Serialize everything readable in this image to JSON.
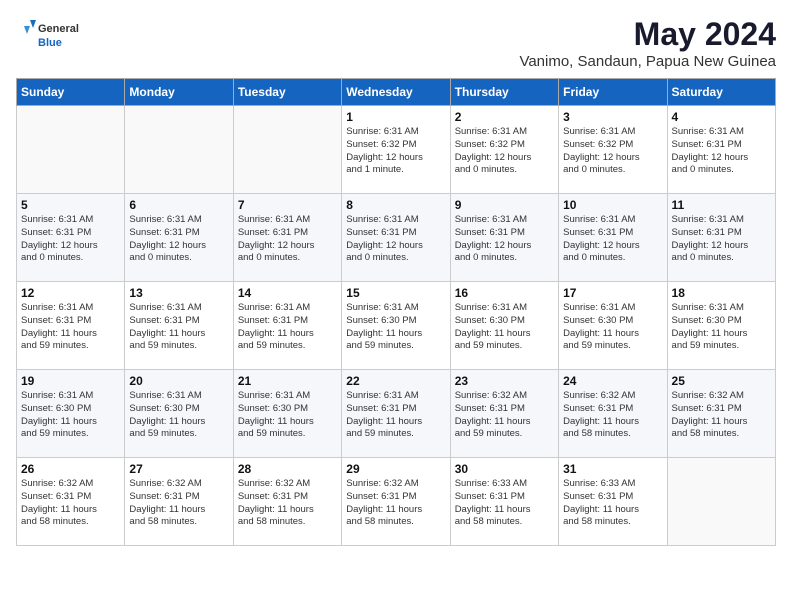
{
  "logo": {
    "general": "General",
    "blue": "Blue"
  },
  "title": "May 2024",
  "subtitle": "Vanimo, Sandaun, Papua New Guinea",
  "weekdays": [
    "Sunday",
    "Monday",
    "Tuesday",
    "Wednesday",
    "Thursday",
    "Friday",
    "Saturday"
  ],
  "weeks": [
    [
      {
        "day": "",
        "text": ""
      },
      {
        "day": "",
        "text": ""
      },
      {
        "day": "",
        "text": ""
      },
      {
        "day": "1",
        "text": "Sunrise: 6:31 AM\nSunset: 6:32 PM\nDaylight: 12 hours\nand 1 minute."
      },
      {
        "day": "2",
        "text": "Sunrise: 6:31 AM\nSunset: 6:32 PM\nDaylight: 12 hours\nand 0 minutes."
      },
      {
        "day": "3",
        "text": "Sunrise: 6:31 AM\nSunset: 6:32 PM\nDaylight: 12 hours\nand 0 minutes."
      },
      {
        "day": "4",
        "text": "Sunrise: 6:31 AM\nSunset: 6:31 PM\nDaylight: 12 hours\nand 0 minutes."
      }
    ],
    [
      {
        "day": "5",
        "text": "Sunrise: 6:31 AM\nSunset: 6:31 PM\nDaylight: 12 hours\nand 0 minutes."
      },
      {
        "day": "6",
        "text": "Sunrise: 6:31 AM\nSunset: 6:31 PM\nDaylight: 12 hours\nand 0 minutes."
      },
      {
        "day": "7",
        "text": "Sunrise: 6:31 AM\nSunset: 6:31 PM\nDaylight: 12 hours\nand 0 minutes."
      },
      {
        "day": "8",
        "text": "Sunrise: 6:31 AM\nSunset: 6:31 PM\nDaylight: 12 hours\nand 0 minutes."
      },
      {
        "day": "9",
        "text": "Sunrise: 6:31 AM\nSunset: 6:31 PM\nDaylight: 12 hours\nand 0 minutes."
      },
      {
        "day": "10",
        "text": "Sunrise: 6:31 AM\nSunset: 6:31 PM\nDaylight: 12 hours\nand 0 minutes."
      },
      {
        "day": "11",
        "text": "Sunrise: 6:31 AM\nSunset: 6:31 PM\nDaylight: 12 hours\nand 0 minutes."
      }
    ],
    [
      {
        "day": "12",
        "text": "Sunrise: 6:31 AM\nSunset: 6:31 PM\nDaylight: 11 hours\nand 59 minutes."
      },
      {
        "day": "13",
        "text": "Sunrise: 6:31 AM\nSunset: 6:31 PM\nDaylight: 11 hours\nand 59 minutes."
      },
      {
        "day": "14",
        "text": "Sunrise: 6:31 AM\nSunset: 6:31 PM\nDaylight: 11 hours\nand 59 minutes."
      },
      {
        "day": "15",
        "text": "Sunrise: 6:31 AM\nSunset: 6:30 PM\nDaylight: 11 hours\nand 59 minutes."
      },
      {
        "day": "16",
        "text": "Sunrise: 6:31 AM\nSunset: 6:30 PM\nDaylight: 11 hours\nand 59 minutes."
      },
      {
        "day": "17",
        "text": "Sunrise: 6:31 AM\nSunset: 6:30 PM\nDaylight: 11 hours\nand 59 minutes."
      },
      {
        "day": "18",
        "text": "Sunrise: 6:31 AM\nSunset: 6:30 PM\nDaylight: 11 hours\nand 59 minutes."
      }
    ],
    [
      {
        "day": "19",
        "text": "Sunrise: 6:31 AM\nSunset: 6:30 PM\nDaylight: 11 hours\nand 59 minutes."
      },
      {
        "day": "20",
        "text": "Sunrise: 6:31 AM\nSunset: 6:30 PM\nDaylight: 11 hours\nand 59 minutes."
      },
      {
        "day": "21",
        "text": "Sunrise: 6:31 AM\nSunset: 6:30 PM\nDaylight: 11 hours\nand 59 minutes."
      },
      {
        "day": "22",
        "text": "Sunrise: 6:31 AM\nSunset: 6:31 PM\nDaylight: 11 hours\nand 59 minutes."
      },
      {
        "day": "23",
        "text": "Sunrise: 6:32 AM\nSunset: 6:31 PM\nDaylight: 11 hours\nand 59 minutes."
      },
      {
        "day": "24",
        "text": "Sunrise: 6:32 AM\nSunset: 6:31 PM\nDaylight: 11 hours\nand 58 minutes."
      },
      {
        "day": "25",
        "text": "Sunrise: 6:32 AM\nSunset: 6:31 PM\nDaylight: 11 hours\nand 58 minutes."
      }
    ],
    [
      {
        "day": "26",
        "text": "Sunrise: 6:32 AM\nSunset: 6:31 PM\nDaylight: 11 hours\nand 58 minutes."
      },
      {
        "day": "27",
        "text": "Sunrise: 6:32 AM\nSunset: 6:31 PM\nDaylight: 11 hours\nand 58 minutes."
      },
      {
        "day": "28",
        "text": "Sunrise: 6:32 AM\nSunset: 6:31 PM\nDaylight: 11 hours\nand 58 minutes."
      },
      {
        "day": "29",
        "text": "Sunrise: 6:32 AM\nSunset: 6:31 PM\nDaylight: 11 hours\nand 58 minutes."
      },
      {
        "day": "30",
        "text": "Sunrise: 6:33 AM\nSunset: 6:31 PM\nDaylight: 11 hours\nand 58 minutes."
      },
      {
        "day": "31",
        "text": "Sunrise: 6:33 AM\nSunset: 6:31 PM\nDaylight: 11 hours\nand 58 minutes."
      },
      {
        "day": "",
        "text": ""
      }
    ]
  ]
}
